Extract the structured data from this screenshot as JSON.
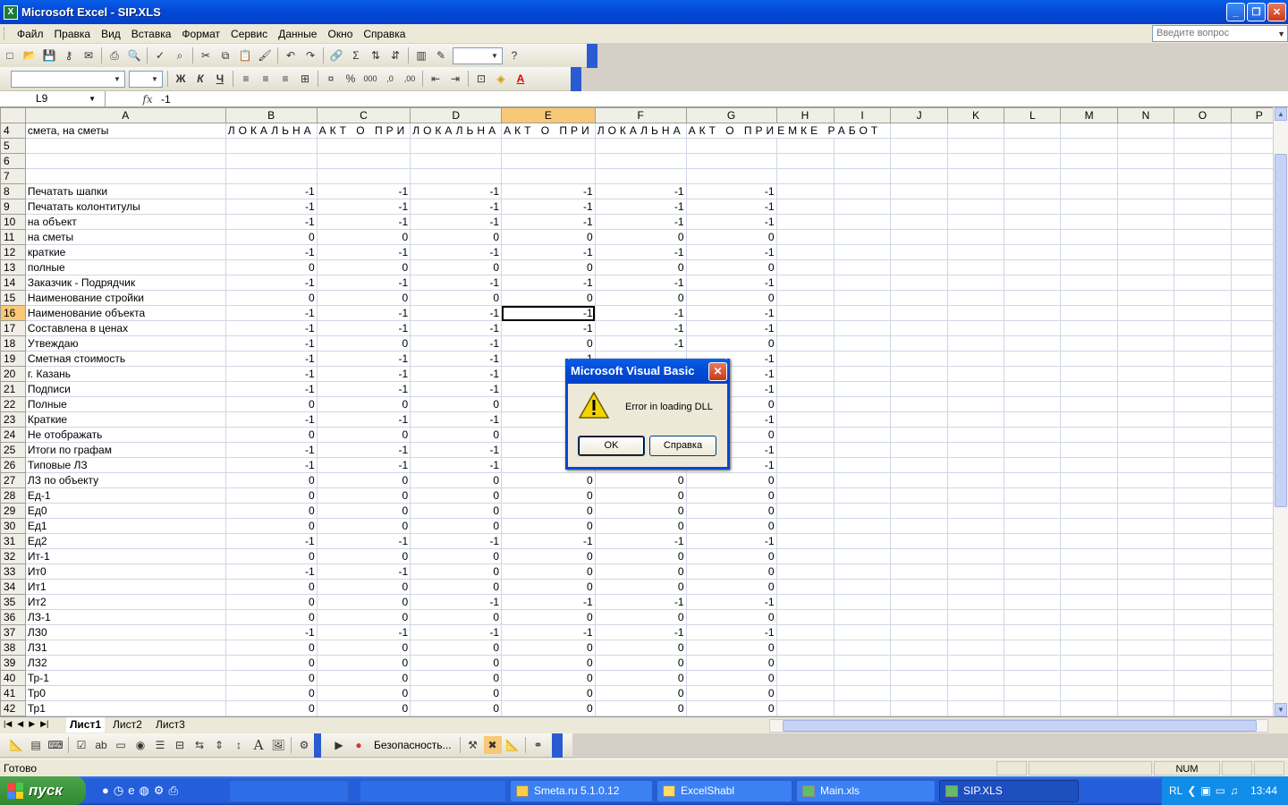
{
  "window": {
    "title": "Microsoft Excel - SIP.XLS",
    "app_icon": "X"
  },
  "menu": {
    "items": [
      "Файл",
      "Правка",
      "Вид",
      "Вставка",
      "Формат",
      "Сервис",
      "Данные",
      "Окно",
      "Справка"
    ],
    "help_placeholder": "Введите вопрос"
  },
  "formula_bar": {
    "cell_ref": "L9",
    "fx": "fx",
    "value": "-1"
  },
  "sheet": {
    "columns": [
      "A",
      "B",
      "C",
      "D",
      "E",
      "F",
      "G",
      "H",
      "I",
      "J",
      "K",
      "L",
      "M",
      "N",
      "O",
      "P"
    ],
    "selected_column": "E",
    "row4": {
      "A": "смета, на сметы",
      "B": "ЛОКАЛЬНА",
      "C": "АКТ О ПРИ",
      "D": "ЛОКАЛЬНА",
      "E": "АКТ О ПРИ",
      "F": "ЛОКАЛЬНА",
      "G": "АКТ О ПРИЕМКЕ РАБОТ"
    },
    "rows": [
      {
        "n": "5",
        "label": "",
        "v": [
          "",
          "",
          "",
          "",
          "",
          ""
        ]
      },
      {
        "n": "6",
        "label": "",
        "v": [
          "",
          "",
          "",
          "",
          "",
          ""
        ]
      },
      {
        "n": "7",
        "label": "",
        "v": [
          "",
          "",
          "",
          "",
          "",
          ""
        ]
      },
      {
        "n": "8",
        "label": "Печатать шапки",
        "v": [
          "-1",
          "-1",
          "-1",
          "-1",
          "-1",
          "-1"
        ]
      },
      {
        "n": "9",
        "label": "Печатать колонтитулы",
        "v": [
          "-1",
          "-1",
          "-1",
          "-1",
          "-1",
          "-1"
        ]
      },
      {
        "n": "10",
        "label": "на объект",
        "v": [
          "-1",
          "-1",
          "-1",
          "-1",
          "-1",
          "-1"
        ]
      },
      {
        "n": "11",
        "label": "на сметы",
        "v": [
          "0",
          "0",
          "0",
          "0",
          "0",
          "0"
        ]
      },
      {
        "n": "12",
        "label": "краткие",
        "v": [
          "-1",
          "-1",
          "-1",
          "-1",
          "-1",
          "-1"
        ]
      },
      {
        "n": "13",
        "label": "полные",
        "v": [
          "0",
          "0",
          "0",
          "0",
          "0",
          "0"
        ]
      },
      {
        "n": "14",
        "label": "Заказчик - Подрядчик",
        "v": [
          "-1",
          "-1",
          "-1",
          "-1",
          "-1",
          "-1"
        ]
      },
      {
        "n": "15",
        "label": "Наименование стройки",
        "v": [
          "0",
          "0",
          "0",
          "0",
          "0",
          "0"
        ]
      },
      {
        "n": "16",
        "label": "Наименование объекта",
        "v": [
          "-1",
          "-1",
          "-1",
          "-1",
          "-1",
          "-1"
        ]
      },
      {
        "n": "17",
        "label": "Составлена в ценах",
        "v": [
          "-1",
          "-1",
          "-1",
          "-1",
          "-1",
          "-1"
        ]
      },
      {
        "n": "18",
        "label": "Утвеждаю",
        "v": [
          "-1",
          "0",
          "-1",
          "0",
          "-1",
          "0"
        ]
      },
      {
        "n": "19",
        "label": "Сметная стоимость",
        "v": [
          "-1",
          "-1",
          "-1",
          "-1",
          "",
          "-1"
        ]
      },
      {
        "n": "20",
        "label": "г. Казань",
        "v": [
          "-1",
          "-1",
          "-1",
          "",
          "",
          "-1"
        ]
      },
      {
        "n": "21",
        "label": "Подписи",
        "v": [
          "-1",
          "-1",
          "-1",
          "",
          "",
          "-1"
        ]
      },
      {
        "n": "22",
        "label": "Полные",
        "v": [
          "0",
          "0",
          "0",
          "",
          "",
          "0"
        ]
      },
      {
        "n": "23",
        "label": "Краткие",
        "v": [
          "-1",
          "-1",
          "-1",
          "",
          "",
          "-1"
        ]
      },
      {
        "n": "24",
        "label": "Не отображать",
        "v": [
          "0",
          "0",
          "0",
          "",
          "",
          "0"
        ]
      },
      {
        "n": "25",
        "label": "Итоги по графам",
        "v": [
          "-1",
          "-1",
          "-1",
          "",
          "",
          "-1"
        ]
      },
      {
        "n": "26",
        "label": "Типовые ЛЗ",
        "v": [
          "-1",
          "-1",
          "-1",
          "",
          "",
          "-1"
        ]
      },
      {
        "n": "27",
        "label": "ЛЗ по объекту",
        "v": [
          "0",
          "0",
          "0",
          "0",
          "0",
          "0"
        ]
      },
      {
        "n": "28",
        "label": "Ед-1",
        "v": [
          "0",
          "0",
          "0",
          "0",
          "0",
          "0"
        ]
      },
      {
        "n": "29",
        "label": "Ед0",
        "v": [
          "0",
          "0",
          "0",
          "0",
          "0",
          "0"
        ]
      },
      {
        "n": "30",
        "label": "Ед1",
        "v": [
          "0",
          "0",
          "0",
          "0",
          "0",
          "0"
        ]
      },
      {
        "n": "31",
        "label": "Ед2",
        "v": [
          "-1",
          "-1",
          "-1",
          "-1",
          "-1",
          "-1"
        ]
      },
      {
        "n": "32",
        "label": "Ит-1",
        "v": [
          "0",
          "0",
          "0",
          "0",
          "0",
          "0"
        ]
      },
      {
        "n": "33",
        "label": "Ит0",
        "v": [
          "-1",
          "-1",
          "0",
          "0",
          "0",
          "0"
        ]
      },
      {
        "n": "34",
        "label": "Ит1",
        "v": [
          "0",
          "0",
          "0",
          "0",
          "0",
          "0"
        ]
      },
      {
        "n": "35",
        "label": "Ит2",
        "v": [
          "0",
          "0",
          "-1",
          "-1",
          "-1",
          "-1"
        ]
      },
      {
        "n": "36",
        "label": "ЛЗ-1",
        "v": [
          "0",
          "0",
          "0",
          "0",
          "0",
          "0"
        ]
      },
      {
        "n": "37",
        "label": "ЛЗ0",
        "v": [
          "-1",
          "-1",
          "-1",
          "-1",
          "-1",
          "-1"
        ]
      },
      {
        "n": "38",
        "label": "ЛЗ1",
        "v": [
          "0",
          "0",
          "0",
          "0",
          "0",
          "0"
        ]
      },
      {
        "n": "39",
        "label": "ЛЗ2",
        "v": [
          "0",
          "0",
          "0",
          "0",
          "0",
          "0"
        ]
      },
      {
        "n": "40",
        "label": "Тр-1",
        "v": [
          "0",
          "0",
          "0",
          "0",
          "0",
          "0"
        ]
      },
      {
        "n": "41",
        "label": "Тр0",
        "v": [
          "0",
          "0",
          "0",
          "0",
          "0",
          "0"
        ]
      },
      {
        "n": "42",
        "label": "Тр1",
        "v": [
          "0",
          "0",
          "0",
          "0",
          "0",
          "0"
        ]
      }
    ],
    "selected_row": "16",
    "tabs": [
      "Лист1",
      "Лист2",
      "Лист3"
    ]
  },
  "drawing_toolbar": {
    "security_label": "Безопасность..."
  },
  "status": {
    "text": "Готово",
    "num": "NUM"
  },
  "dialog": {
    "title": "Microsoft Visual Basic",
    "message": "Error in loading DLL",
    "ok_label": "OK",
    "help_label": "Справка"
  },
  "taskbar": {
    "start_label": "пуск",
    "tasks": [
      "Smeta.ru  5.1.0.12",
      "ExcelShabl",
      "Main.xls",
      "SIP.XLS"
    ],
    "active_task": "SIP.XLS",
    "lang": "RL",
    "time": "13:44"
  }
}
